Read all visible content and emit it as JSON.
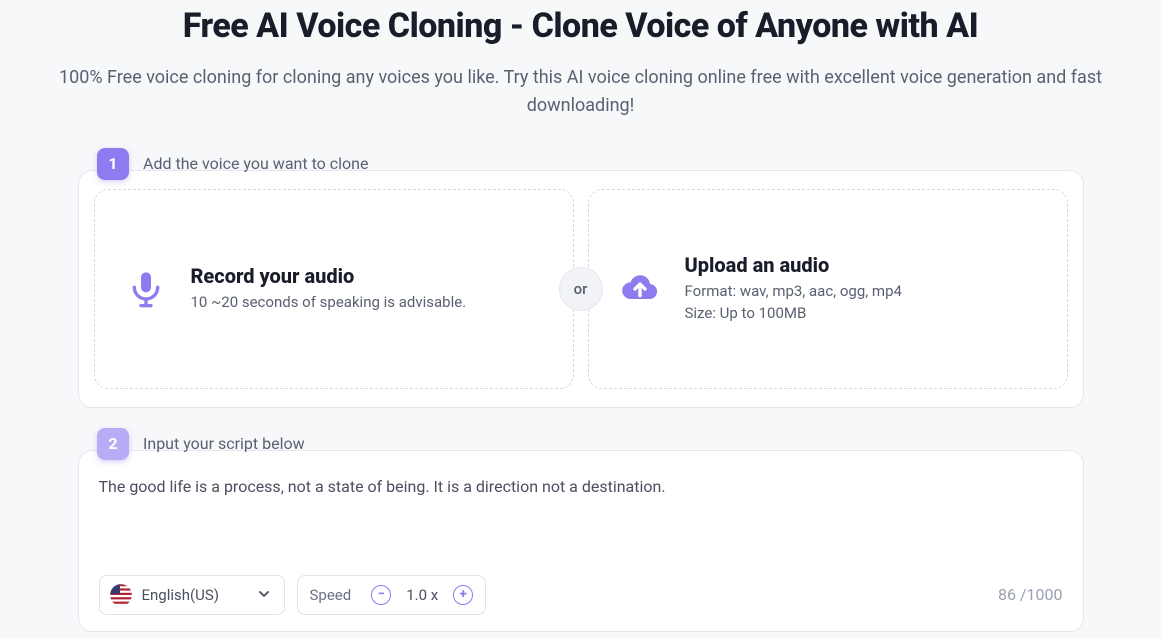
{
  "header": {
    "title": "Free AI Voice Cloning - Clone Voice of Anyone with AI",
    "subtitle": "100% Free voice cloning for cloning any voices you like. Try this AI voice cloning online free with excellent voice generation and fast downloading!"
  },
  "step1": {
    "badge": "1",
    "label": "Add the voice you want to clone",
    "or": "or",
    "record": {
      "title": "Record your audio",
      "desc": "10 ~20 seconds of speaking is advisable."
    },
    "upload": {
      "title": "Upload an audio",
      "desc_line1": "Format: wav, mp3, aac, ogg, mp4",
      "desc_line2": "Size: Up to 100MB"
    }
  },
  "step2": {
    "badge": "2",
    "label": "Input your script below",
    "script_text": "The good life is a process, not a state of being. It is a direction not a destination.",
    "language": "English(US)",
    "speed_label": "Speed",
    "speed_value": "1.0 x",
    "char_count": "86 /1000"
  }
}
